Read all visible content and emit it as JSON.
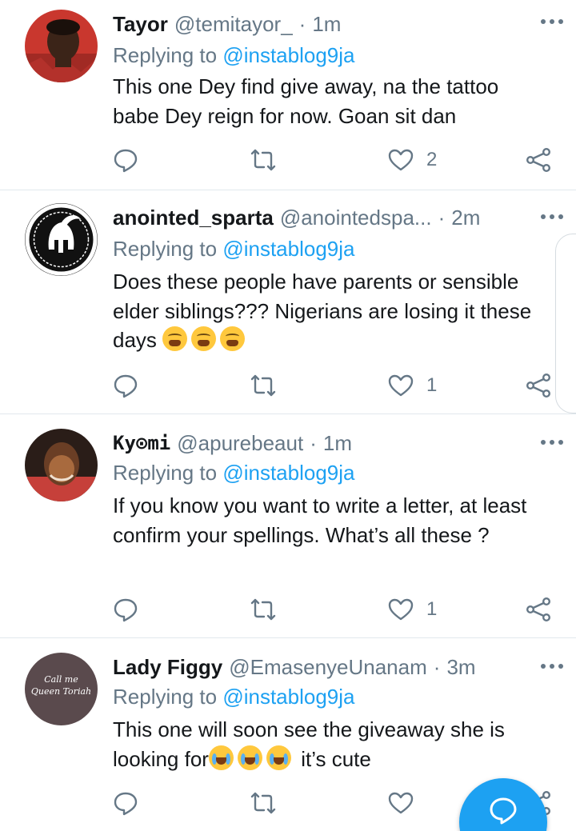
{
  "colors": {
    "accent": "#1da1f2",
    "secondary_text": "#657786",
    "divider": "#e1e8ed"
  },
  "tweets": [
    {
      "name": "Tayor",
      "handle": "@temitayor_",
      "separator": "·",
      "time": "1m",
      "replying_prefix": "Replying to",
      "replying_to": "@instablog9ja",
      "text": "This one Dey find give away, na the tattoo babe Dey reign for now. Goan sit dan",
      "like_count": "2",
      "avatar": "profile-photo"
    },
    {
      "name": "anointed_sparta",
      "handle": "@anointedspa...",
      "separator": "·",
      "time": "2m",
      "replying_prefix": "Replying to",
      "replying_to": "@instablog9ja",
      "text": "Does these people have parents or sensible elder siblings??? Nigerians are losing it these days",
      "emoji": [
        "tired-face",
        "tired-face",
        "tired-face"
      ],
      "like_count": "1",
      "avatar": "spartan-helmet-logo",
      "avatar_caption": "Anointed Sparta"
    },
    {
      "name": "Ky⊙mi",
      "handle": "@apurebeaut",
      "separator": "·",
      "time": "1m",
      "replying_prefix": "Replying to",
      "replying_to": "@instablog9ja",
      "text": "If you know you want to write a letter, at least confirm your spellings. What’s all these ?",
      "like_count": "1",
      "avatar": "profile-photo"
    },
    {
      "name": "Lady Figgy",
      "handle": "@EmasenyeUnanam",
      "separator": "·",
      "time": "3m",
      "replying_prefix": "Replying to",
      "replying_to": "@instablog9ja",
      "text_before": "This one will soon see the giveaway she is looking for",
      "emoji": [
        "tears-of-joy",
        "tears-of-joy",
        "tears-of-joy"
      ],
      "text_after": " it’s cute",
      "like_count": "",
      "avatar": "text-avatar",
      "avatar_text_line1": "Call me",
      "avatar_text_line2": "Queen Toriah"
    }
  ],
  "icons": {
    "reply": "reply-icon",
    "retweet": "retweet-icon",
    "like": "heart-icon",
    "share": "share-icon",
    "more": "more-icon",
    "compose": "compose-reply-icon"
  }
}
